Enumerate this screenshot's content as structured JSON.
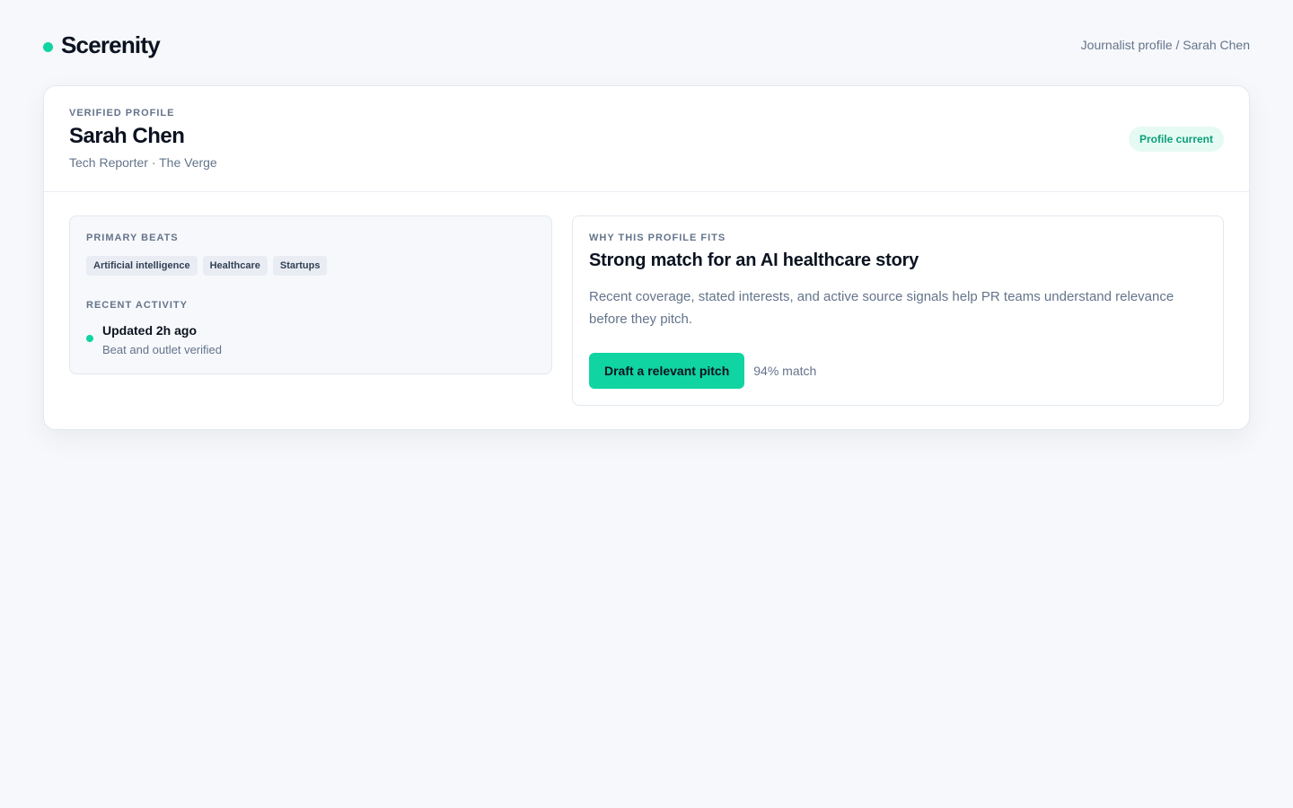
{
  "brand": {
    "name": "Scerenity",
    "accent_color": "#10d4a2"
  },
  "breadcrumb": "Journalist profile / Sarah Chen",
  "profile": {
    "eyebrow": "VERIFIED PROFILE",
    "name": "Sarah Chen",
    "subtitle": "Tech Reporter · The Verge",
    "status": "Profile current"
  },
  "beats": {
    "heading": "PRIMARY BEATS",
    "items": [
      "Artificial intelligence",
      "Healthcare",
      "Startups"
    ]
  },
  "activity": {
    "heading": "RECENT ACTIVITY",
    "title": "Updated 2h ago",
    "detail": "Beat and outlet verified"
  },
  "fit": {
    "heading": "WHY THIS PROFILE FITS",
    "title": "Strong match for an AI healthcare story",
    "description": "Recent coverage, stated interests, and active source signals help PR teams understand relevance before they pitch.",
    "button_label": "Draft a relevant pitch",
    "match": "94% match"
  }
}
